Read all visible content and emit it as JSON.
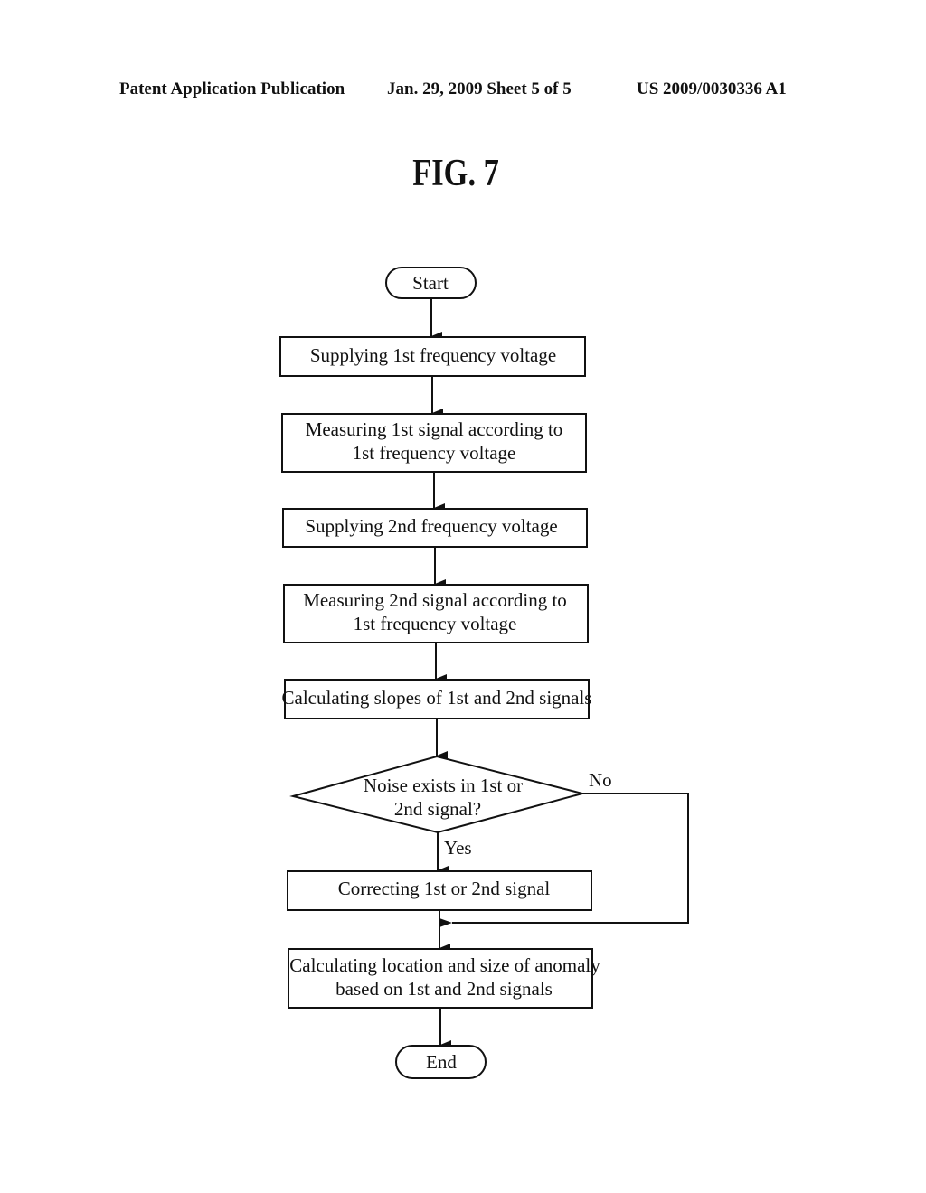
{
  "header": {
    "publication_label": "Patent Application Publication",
    "date_sheet": "Jan. 29, 2009  Sheet 5 of 5",
    "patent_number": "US 2009/0030336 A1"
  },
  "figure": {
    "title": "FIG. 7"
  },
  "flowchart": {
    "start": "Start",
    "end": "End",
    "steps": [
      {
        "lines": [
          "Supplying 1st frequency voltage"
        ]
      },
      {
        "lines": [
          "Measuring 1st signal according to",
          "1st frequency voltage"
        ]
      },
      {
        "lines": [
          "Supplying 2nd frequency voltage"
        ]
      },
      {
        "lines": [
          "Measuring 2nd signal according to",
          "1st frequency voltage"
        ]
      },
      {
        "lines": [
          "Calculating slopes of 1st and 2nd signals"
        ]
      }
    ],
    "decision": {
      "lines": [
        "Noise exists in 1st or",
        "2nd signal?"
      ],
      "yes_label": "Yes",
      "no_label": "No"
    },
    "correction_step": {
      "lines": [
        "Correcting 1st or 2nd signal"
      ]
    },
    "final_step": {
      "lines": [
        "Calculating location and size of anomaly",
        "based on 1st and 2nd signals"
      ]
    }
  }
}
